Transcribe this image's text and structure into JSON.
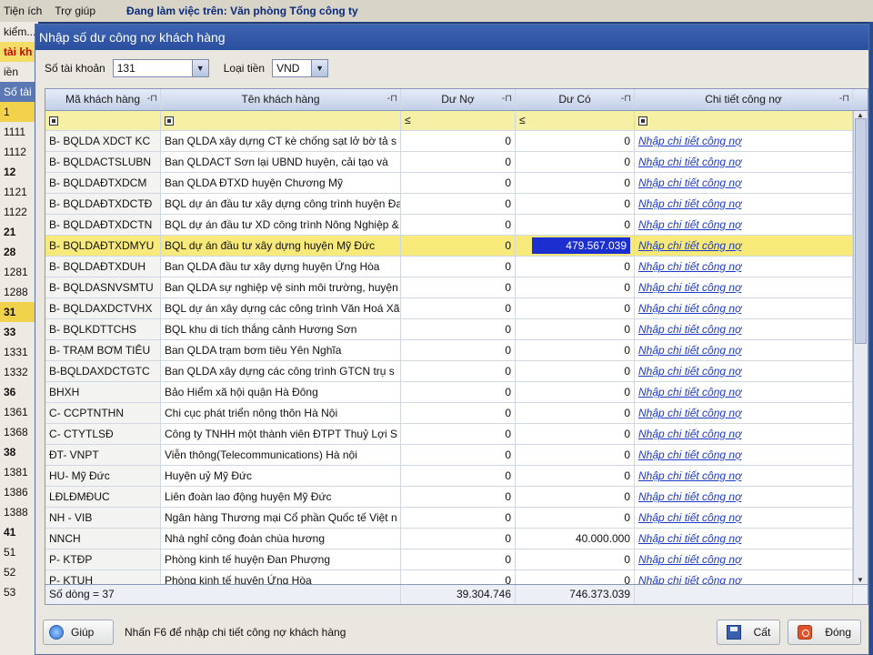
{
  "app": {
    "menu": [
      "Tiện ích",
      "Trợ giúp"
    ],
    "working_label": "Đang làm việc trên:",
    "working_value": "Văn phòng Tổng công ty",
    "sidebar_rows": [
      "kiểm...",
      "tài kh",
      "iền",
      "Số tài",
      "1",
      "1111",
      "1112",
      "12",
      "1121",
      "1122",
      "21",
      "28",
      "1281",
      "1288",
      "31",
      "33",
      "1331",
      "1332",
      "36",
      "1361",
      "1368",
      "38",
      "1381",
      "1386",
      "1388",
      "41",
      "51",
      "52",
      "53"
    ]
  },
  "dialog": {
    "title": "Nhập số dư công nợ khách hàng",
    "account_label": "Số tài khoản",
    "account_value": "131",
    "currency_label": "Loại tiền",
    "currency_value": "VND"
  },
  "grid": {
    "columns": [
      "Mã khách hàng",
      "Tên khách hàng",
      "Dư Nợ",
      "Dư Có",
      "Chi tiết công nợ"
    ],
    "filter_ops": [
      "",
      "",
      "≤",
      "≤",
      ""
    ],
    "link_text": "Nhập chi tiết công nợ",
    "rows": [
      {
        "code": "B- BQLDA XDCT KC",
        "name": "Ban QLDA xây dựng CT kè chống sạt lở bờ tả s",
        "debit": "0",
        "credit": "0"
      },
      {
        "code": "B- BQLDACTSLUBN",
        "name": "Ban QLDACT Sơn lại UBND huyện, cải tạo và",
        "debit": "0",
        "credit": "0"
      },
      {
        "code": "B- BQLDAĐTXDCM",
        "name": "Ban QLDA ĐTXD huyện Chương Mỹ",
        "debit": "0",
        "credit": "0"
      },
      {
        "code": "B- BQLDAĐTXDCTĐ",
        "name": "BQL dự án đầu tư xây dựng công trình huyện Đa",
        "debit": "0",
        "credit": "0"
      },
      {
        "code": "B- BQLDAĐTXDCTN",
        "name": "BQL dự án đầu tư XD công trình Nông Nghiệp &",
        "debit": "0",
        "credit": "0"
      },
      {
        "code": "B- BQLDAĐTXDMYU",
        "name": "BQL dự án đầu tư xây dựng  huyện Mỹ Đức",
        "debit": "0",
        "credit": "479.567.039",
        "selected": true
      },
      {
        "code": "B- BQLDAĐTXDUH",
        "name": "Ban QLDA đầu tư xây dựng huyện Ứng Hòa",
        "debit": "0",
        "credit": "0"
      },
      {
        "code": "B- BQLDASNVSMTU",
        "name": "Ban QLDA sự nghiệp vệ sinh môi trường, huyện",
        "debit": "0",
        "credit": "0"
      },
      {
        "code": "B- BQLDAXDCTVHX",
        "name": "BQL dự án xây dựng các công trình Văn Hoá Xã",
        "debit": "0",
        "credit": "0"
      },
      {
        "code": "B- BQLKDTTCHS",
        "name": "BQL khu di tích thắng cảnh Hương Sơn",
        "debit": "0",
        "credit": "0"
      },
      {
        "code": "B- TRẠM BƠM TIÊU",
        "name": "Ban QLDA trạm bơm tiêu Yên Nghĩa",
        "debit": "0",
        "credit": "0"
      },
      {
        "code": "B-BQLDAXDCTGTC",
        "name": "Ban QLDA xây dựng các công trình GTCN trụ s",
        "debit": "0",
        "credit": "0"
      },
      {
        "code": "BHXH",
        "name": "Bảo Hiểm xã hội quận Hà Đông",
        "debit": "0",
        "credit": "0"
      },
      {
        "code": "C- CCPTNTHN",
        "name": "Chi cục phát triển nông thôn Hà Nội",
        "debit": "0",
        "credit": "0"
      },
      {
        "code": "C- CTYTLSĐ",
        "name": "Công ty TNHH một thành viên ĐTPT Thuỷ Lợi S",
        "debit": "0",
        "credit": "0"
      },
      {
        "code": "ĐT- VNPT",
        "name": "Viễn thông(Telecommunications) Hà nội",
        "debit": "0",
        "credit": "0"
      },
      {
        "code": "HU- Mỹ Đức",
        "name": "Huyện uỷ Mỹ Đức",
        "debit": "0",
        "credit": "0"
      },
      {
        "code": "LĐLĐMĐUC",
        "name": "Liên đoàn lao động huyện Mỹ Đức",
        "debit": "0",
        "credit": "0"
      },
      {
        "code": "NH - VIB",
        "name": "Ngân hàng Thương mại Cổ phần Quốc tế Việt n",
        "debit": "0",
        "credit": "0"
      },
      {
        "code": "NNCH",
        "name": "Nhà nghỉ công đoàn chùa hương",
        "debit": "0",
        "credit": "40.000.000"
      },
      {
        "code": "P- KTĐP",
        "name": "Phòng kinh tế huyện Đan Phượng",
        "debit": "0",
        "credit": "0"
      },
      {
        "code": "P- KTUH",
        "name": "Phòng kinh tế huyện Ứng Hòa",
        "debit": "0",
        "credit": "0"
      }
    ],
    "row_count_label": "Số dòng = 37",
    "total_debit": "39.304.746",
    "total_credit": "746.373.039"
  },
  "status": {
    "help_label": "Giúp",
    "hint": "Nhấn F6 để nhập chi tiết công nợ khách hàng",
    "save_label": "Cất",
    "close_label": "Đóng"
  },
  "colors": {
    "title_bar": "#2a4f9e",
    "selected_row": "#f7ea7a",
    "selected_cell": "#1b2fd1",
    "link": "#1c39c8"
  }
}
